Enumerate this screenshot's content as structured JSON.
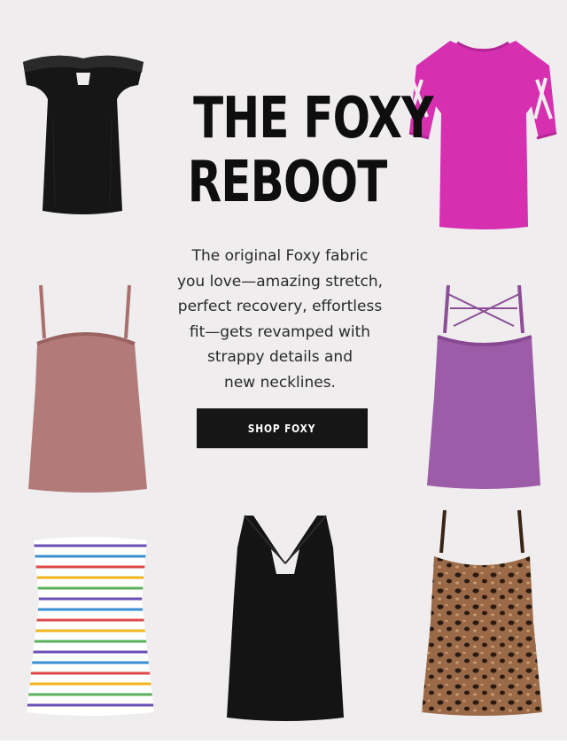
{
  "hero": {
    "headline_line1": "THE FOXY",
    "headline_line2": "REBOOT",
    "body_lines": [
      "The original Foxy fabric",
      "you love—amazing stretch,",
      "perfect recovery, effortless",
      "fit—gets revamped with",
      "strappy details and",
      "new necklines."
    ],
    "cta_label": "SHOP FOXY"
  },
  "products": [
    {
      "name": "black-off-shoulder-top",
      "color": "#151515"
    },
    {
      "name": "pink-cold-shoulder-top",
      "color": "#d62fb0"
    },
    {
      "name": "mauve-cami",
      "color": "#b07a7a"
    },
    {
      "name": "purple-strappy-cami",
      "color": "#9c5ba6"
    },
    {
      "name": "rainbow-stripe-tube-top",
      "color": "#ffffff"
    },
    {
      "name": "black-cross-back-tank",
      "color": "#141414"
    },
    {
      "name": "leopard-print-cami",
      "color": "#8a5a3c"
    }
  ],
  "colors": {
    "background": "#efedee",
    "button": "#161616",
    "text": "#0e0e0e"
  }
}
